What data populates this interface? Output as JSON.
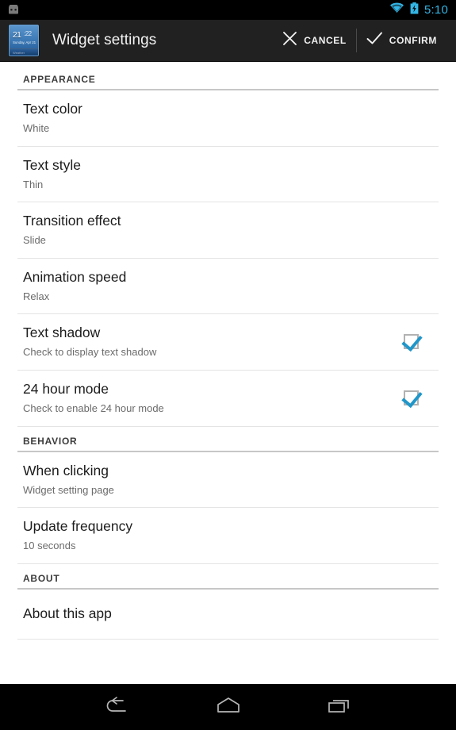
{
  "status_bar": {
    "notification_icon": "android-robot-icon",
    "wifi_icon": "wifi-icon",
    "battery_icon": "battery-charging-icon",
    "clock": "5:10",
    "clock_color": "#33b5e5",
    "background": "#000000"
  },
  "action_bar": {
    "background": "#212121",
    "app_icon": {
      "name": "widget-preview-icon",
      "time_hour": "21",
      "time_minutes": ":22",
      "date": "Sunday, Apr 21",
      "strip_text": "Weather",
      "accent": "#3f7cb8"
    },
    "title": "Widget settings",
    "cancel": {
      "label": "CANCEL",
      "icon": "close-icon"
    },
    "confirm": {
      "label": "CONFIRM",
      "icon": "check-icon"
    }
  },
  "sections": [
    {
      "header": "APPEARANCE",
      "rows": [
        {
          "title": "Text color",
          "summary": "White",
          "type": "value"
        },
        {
          "title": "Text style",
          "summary": "Thin",
          "type": "value"
        },
        {
          "title": "Transition effect",
          "summary": "Slide",
          "type": "value"
        },
        {
          "title": "Animation speed",
          "summary": "Relax",
          "type": "value"
        },
        {
          "title": "Text shadow",
          "summary": "Check to display text shadow",
          "type": "checkbox",
          "checked": true
        },
        {
          "title": "24 hour mode",
          "summary": "Check to enable 24 hour mode",
          "type": "checkbox",
          "checked": true
        }
      ]
    },
    {
      "header": "BEHAVIOR",
      "rows": [
        {
          "title": "When clicking",
          "summary": "Widget setting page",
          "type": "value"
        },
        {
          "title": "Update frequency",
          "summary": "10 seconds",
          "type": "value"
        }
      ]
    },
    {
      "header": "ABOUT",
      "rows": [
        {
          "title": "About this app",
          "summary": "",
          "type": "plain"
        }
      ]
    }
  ],
  "nav_bar": {
    "background": "#000000",
    "back": "back-icon",
    "home": "home-icon",
    "recents": "recents-icon"
  },
  "colors": {
    "accent": "#33b5e5",
    "checkbox_check": "#2196c9",
    "divider": "#e4e4e4",
    "section_rule": "#c7c7c7"
  }
}
